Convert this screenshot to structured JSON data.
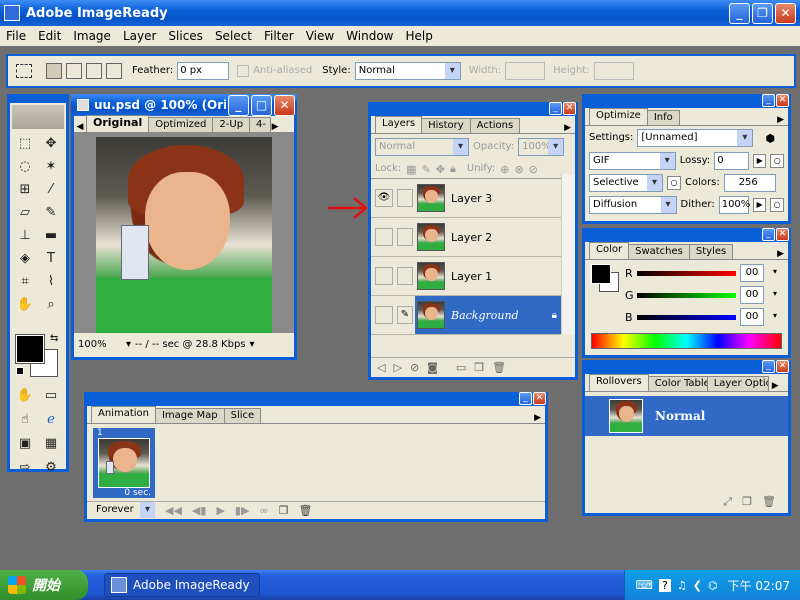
{
  "app": {
    "title": "Adobe ImageReady"
  },
  "menu": [
    "File",
    "Edit",
    "Image",
    "Layer",
    "Slices",
    "Select",
    "Filter",
    "View",
    "Window",
    "Help"
  ],
  "options": {
    "feather_label": "Feather:",
    "feather_value": "0 px",
    "antialias_label": "Anti-aliased",
    "style_label": "Style:",
    "style_value": "Normal",
    "width_label": "Width:",
    "height_label": "Height:"
  },
  "doc": {
    "title": "uu.psd @ 100% (Ori...",
    "tabs": [
      "Original",
      "Optimized",
      "2-Up",
      "4-"
    ],
    "zoom": "100%",
    "status": "-- / -- sec @ 28.8 Kbps"
  },
  "layers": {
    "tabs": [
      "Layers",
      "History",
      "Actions"
    ],
    "blend": "Normal",
    "opacity_label": "Opacity:",
    "opacity_value": "100%",
    "lock_label": "Lock:",
    "unify_label": "Unify:",
    "items": [
      {
        "name": "Layer 3"
      },
      {
        "name": "Layer 2"
      },
      {
        "name": "Layer 1"
      },
      {
        "name": "Background"
      }
    ]
  },
  "optimize": {
    "tabs": [
      "Optimize",
      "Info"
    ],
    "settings_label": "Settings:",
    "settings_value": "[Unnamed]",
    "format": "GIF",
    "lossy_label": "Lossy:",
    "lossy_value": "0",
    "palette": "Selective",
    "colors_label": "Colors:",
    "colors_value": "256",
    "dither_algo": "Diffusion",
    "dither_label": "Dither:",
    "dither_value": "100%"
  },
  "color": {
    "tabs": [
      "Color",
      "Swatches",
      "Styles"
    ],
    "r_label": "R",
    "g_label": "G",
    "b_label": "B",
    "r": "00",
    "g": "00",
    "b": "00"
  },
  "rollovers": {
    "tabs": [
      "Rollovers",
      "Color Table",
      "Layer Options"
    ],
    "state": "Normal"
  },
  "animation": {
    "tabs": [
      "Animation",
      "Image Map",
      "Slice"
    ],
    "frame_number": "1",
    "frame_delay": "0 sec.",
    "loop": "Forever"
  },
  "taskbar": {
    "start": "開始",
    "task": "Adobe ImageReady",
    "clock": "下午 02:07"
  },
  "colors": {
    "annotation_arrow": "#e01010",
    "selected_row": "#316ac5"
  }
}
